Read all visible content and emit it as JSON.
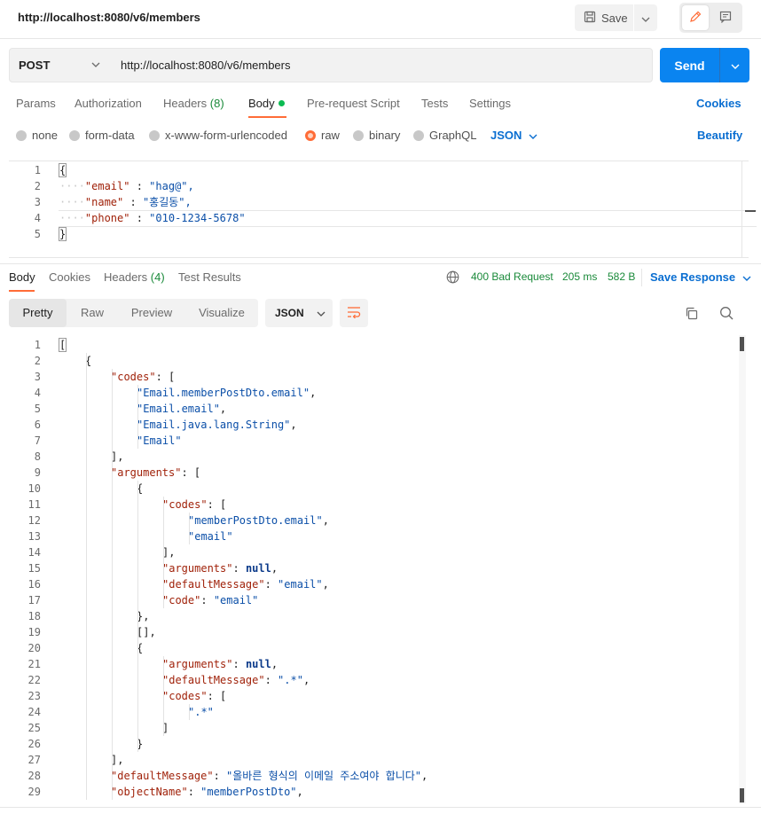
{
  "title_bar": {
    "url": "http://localhost:8080/v6/members",
    "save_label": "Save"
  },
  "request": {
    "method": "POST",
    "url": "http://localhost:8080/v6/members",
    "send_label": "Send"
  },
  "request_tabs": {
    "params": "Params",
    "authorization": "Authorization",
    "headers": "Headers",
    "headers_count": "(8)",
    "body": "Body",
    "prerequest": "Pre-request Script",
    "tests": "Tests",
    "settings": "Settings",
    "cookies": "Cookies"
  },
  "body_types": {
    "none": "none",
    "form_data": "form-data",
    "urlencoded": "x-www-form-urlencoded",
    "raw": "raw",
    "binary": "binary",
    "graphql": "GraphQL",
    "selected": "raw",
    "language": "JSON",
    "beautify": "Beautify"
  },
  "request_body": {
    "lines": [
      {
        "n": "1",
        "text": "{"
      },
      {
        "n": "2",
        "key": "\"email\"",
        "val": "\"hag@\","
      },
      {
        "n": "3",
        "key": "\"name\"",
        "val": "\"홍길동\","
      },
      {
        "n": "4",
        "key": "\"phone\"",
        "val": "\"010-1234-5678\""
      },
      {
        "n": "5",
        "text": "}"
      }
    ]
  },
  "response_tabs": {
    "body": "Body",
    "cookies": "Cookies",
    "headers": "Headers",
    "headers_count": "(4)",
    "test_results": "Test Results",
    "status": "400 Bad Request",
    "time": "205 ms",
    "size": "582 B",
    "save_response": "Save Response"
  },
  "response_toolbar": {
    "views": [
      "Pretty",
      "Raw",
      "Preview",
      "Visualize"
    ],
    "active_view": "Pretty",
    "format": "JSON"
  },
  "response_body": {
    "line_numbers": [
      "1",
      "2",
      "3",
      "4",
      "5",
      "6",
      "7",
      "8",
      "9",
      "10",
      "11",
      "12",
      "13",
      "14",
      "15",
      "16",
      "17",
      "18",
      "19",
      "20",
      "21",
      "22",
      "23",
      "24",
      "25",
      "26",
      "27",
      "28",
      "29"
    ],
    "lines": [
      {
        "indent": 0,
        "parts": [
          {
            "t": "[",
            "c": "pun"
          }
        ]
      },
      {
        "indent": 1,
        "parts": [
          {
            "t": "{",
            "c": "pun"
          }
        ]
      },
      {
        "indent": 2,
        "parts": [
          {
            "t": "\"codes\"",
            "c": "key"
          },
          {
            "t": ": [",
            "c": "pun"
          }
        ]
      },
      {
        "indent": 3,
        "parts": [
          {
            "t": "\"Email.memberPostDto.email\"",
            "c": "str"
          },
          {
            "t": ",",
            "c": "pun"
          }
        ]
      },
      {
        "indent": 3,
        "parts": [
          {
            "t": "\"Email.email\"",
            "c": "str"
          },
          {
            "t": ",",
            "c": "pun"
          }
        ]
      },
      {
        "indent": 3,
        "parts": [
          {
            "t": "\"Email.java.lang.String\"",
            "c": "str"
          },
          {
            "t": ",",
            "c": "pun"
          }
        ]
      },
      {
        "indent": 3,
        "parts": [
          {
            "t": "\"Email\"",
            "c": "str"
          }
        ]
      },
      {
        "indent": 2,
        "parts": [
          {
            "t": "],",
            "c": "pun"
          }
        ]
      },
      {
        "indent": 2,
        "parts": [
          {
            "t": "\"arguments\"",
            "c": "key"
          },
          {
            "t": ": [",
            "c": "pun"
          }
        ]
      },
      {
        "indent": 3,
        "parts": [
          {
            "t": "{",
            "c": "pun"
          }
        ]
      },
      {
        "indent": 4,
        "parts": [
          {
            "t": "\"codes\"",
            "c": "key"
          },
          {
            "t": ": [",
            "c": "pun"
          }
        ]
      },
      {
        "indent": 5,
        "parts": [
          {
            "t": "\"memberPostDto.email\"",
            "c": "str"
          },
          {
            "t": ",",
            "c": "pun"
          }
        ]
      },
      {
        "indent": 5,
        "parts": [
          {
            "t": "\"email\"",
            "c": "str"
          }
        ]
      },
      {
        "indent": 4,
        "parts": [
          {
            "t": "],",
            "c": "pun"
          }
        ]
      },
      {
        "indent": 4,
        "parts": [
          {
            "t": "\"arguments\"",
            "c": "key"
          },
          {
            "t": ": ",
            "c": "pun"
          },
          {
            "t": "null",
            "c": "kw"
          },
          {
            "t": ",",
            "c": "pun"
          }
        ]
      },
      {
        "indent": 4,
        "parts": [
          {
            "t": "\"defaultMessage\"",
            "c": "key"
          },
          {
            "t": ": ",
            "c": "pun"
          },
          {
            "t": "\"email\"",
            "c": "str"
          },
          {
            "t": ",",
            "c": "pun"
          }
        ]
      },
      {
        "indent": 4,
        "parts": [
          {
            "t": "\"code\"",
            "c": "key"
          },
          {
            "t": ": ",
            "c": "pun"
          },
          {
            "t": "\"email\"",
            "c": "str"
          }
        ]
      },
      {
        "indent": 3,
        "parts": [
          {
            "t": "},",
            "c": "pun"
          }
        ]
      },
      {
        "indent": 3,
        "parts": [
          {
            "t": "[],",
            "c": "pun"
          }
        ]
      },
      {
        "indent": 3,
        "parts": [
          {
            "t": "{",
            "c": "pun"
          }
        ]
      },
      {
        "indent": 4,
        "parts": [
          {
            "t": "\"arguments\"",
            "c": "key"
          },
          {
            "t": ": ",
            "c": "pun"
          },
          {
            "t": "null",
            "c": "kw"
          },
          {
            "t": ",",
            "c": "pun"
          }
        ]
      },
      {
        "indent": 4,
        "parts": [
          {
            "t": "\"defaultMessage\"",
            "c": "key"
          },
          {
            "t": ": ",
            "c": "pun"
          },
          {
            "t": "\".*\"",
            "c": "str"
          },
          {
            "t": ",",
            "c": "pun"
          }
        ]
      },
      {
        "indent": 4,
        "parts": [
          {
            "t": "\"codes\"",
            "c": "key"
          },
          {
            "t": ": [",
            "c": "pun"
          }
        ]
      },
      {
        "indent": 5,
        "parts": [
          {
            "t": "\".*\"",
            "c": "str"
          }
        ]
      },
      {
        "indent": 4,
        "parts": [
          {
            "t": "]",
            "c": "pun"
          }
        ]
      },
      {
        "indent": 3,
        "parts": [
          {
            "t": "}",
            "c": "pun"
          }
        ]
      },
      {
        "indent": 2,
        "parts": [
          {
            "t": "],",
            "c": "pun"
          }
        ]
      },
      {
        "indent": 2,
        "parts": [
          {
            "t": "\"defaultMessage\"",
            "c": "key"
          },
          {
            "t": ": ",
            "c": "pun"
          },
          {
            "t": "\"올바른 형식의 이메일 주소여야 합니다\"",
            "c": "str"
          },
          {
            "t": ",",
            "c": "pun"
          }
        ]
      },
      {
        "indent": 2,
        "parts": [
          {
            "t": "\"objectName\"",
            "c": "key"
          },
          {
            "t": ": ",
            "c": "pun"
          },
          {
            "t": "\"memberPostDto\"",
            "c": "str"
          },
          {
            "t": ",",
            "c": "pun"
          }
        ]
      }
    ]
  },
  "icons": {
    "save": "save-icon",
    "edit": "pencil-icon",
    "comments": "comment-icon",
    "globe": "globe-icon",
    "wrap": "wrap-lines-icon",
    "copy": "copy-icon",
    "search": "search-icon"
  },
  "colors": {
    "accent": "#ff6c37",
    "send": "#0a84f0",
    "link": "#0a6ed1",
    "status": "#1a8a3a"
  }
}
